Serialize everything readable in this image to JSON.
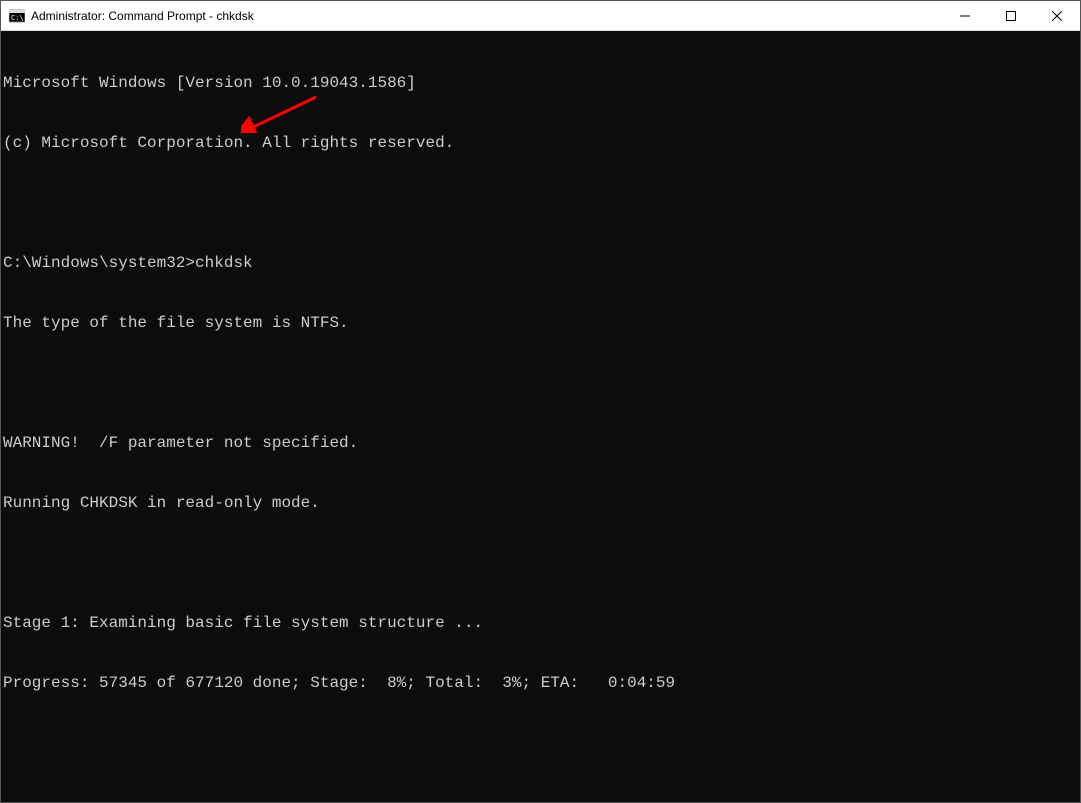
{
  "titlebar": {
    "title": "Administrator: Command Prompt - chkdsk"
  },
  "terminal": {
    "lines": [
      "Microsoft Windows [Version 10.0.19043.1586]",
      "(c) Microsoft Corporation. All rights reserved.",
      "",
      "C:\\Windows\\system32>chkdsk",
      "The type of the file system is NTFS.",
      "",
      "WARNING!  /F parameter not specified.",
      "Running CHKDSK in read-only mode.",
      "",
      "Stage 1: Examining basic file system structure ...",
      "Progress: 57345 of 677120 done; Stage:  8%; Total:  3%; ETA:   0:04:59"
    ]
  }
}
